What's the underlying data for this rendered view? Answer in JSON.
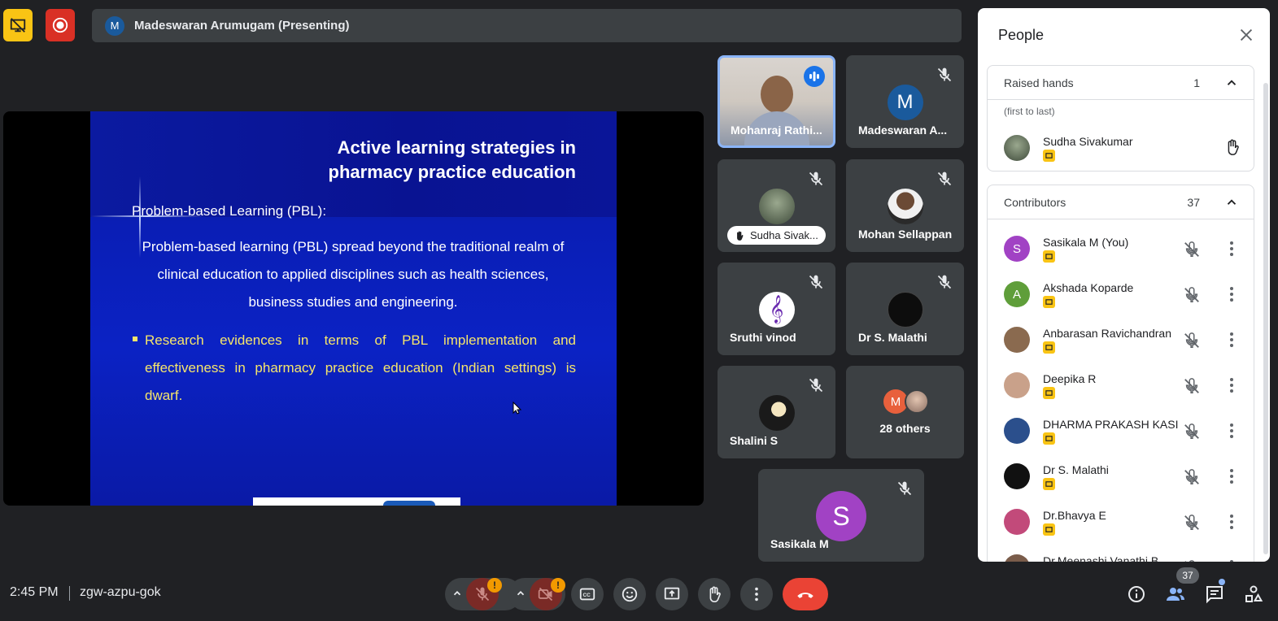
{
  "header": {
    "presenter_initial": "M",
    "presenter_label": "Madeswaran Arumugam (Presenting)"
  },
  "slide": {
    "title_line1": "Active learning strategies in",
    "title_line2": "pharmacy practice education",
    "subheading": "Problem-based Learning (PBL):",
    "paragraph": "Problem-based learning (PBL) spread beyond the traditional realm of clinical education to applied disciplines such as health sciences, business studies and engineering.",
    "bullet": "Research evidences in terms of PBL implementation and effectiveness in pharmacy practice education (Indian settings) is dwarf."
  },
  "tiles": {
    "t1": {
      "name": "Mohanraj Rathi..."
    },
    "t2": {
      "name": "Madeswaran A...",
      "initial": "M"
    },
    "t3": {
      "name": "Sudha Sivak..."
    },
    "t4": {
      "name": "Mohan Sellappan"
    },
    "t5": {
      "name": "Sruthi vinod"
    },
    "t6": {
      "name": "Dr S. Malathi"
    },
    "t7": {
      "name": "Shalini S"
    },
    "t8": {
      "name": "28 others",
      "initial": "M"
    },
    "t9": {
      "name": "Sasikala M",
      "initial": "S"
    }
  },
  "people": {
    "title": "People",
    "raised": {
      "title": "Raised hands",
      "count": "1",
      "note": "(first to last)",
      "person": "Sudha Sivakumar"
    },
    "contributors": {
      "title": "Contributors",
      "count": "37",
      "list": [
        {
          "name": "Sasikala M (You)",
          "initial": "S",
          "color": "#a142c4"
        },
        {
          "name": "Akshada Koparde",
          "initial": "A",
          "color": "#5f9e3a"
        },
        {
          "name": "Anbarasan Ravichandran",
          "initial": "",
          "color": "#8a6a4f"
        },
        {
          "name": "Deepika R",
          "initial": "",
          "color": "#c9a18a"
        },
        {
          "name": "DHARMA PRAKASH KASI",
          "initial": "",
          "color": "#2b4f8c"
        },
        {
          "name": "Dr S. Malathi",
          "initial": "",
          "color": "#111111"
        },
        {
          "name": "Dr.Bhavya E",
          "initial": "",
          "color": "#c24a7a"
        },
        {
          "name": "Dr.Meenashi Vanathi B",
          "initial": "",
          "color": "#7a5c4a"
        }
      ]
    }
  },
  "footer": {
    "time": "2:45 PM",
    "meeting_code": "zgw-azpu-gok",
    "alert_mark": "!",
    "people_count": "37"
  },
  "colors": {
    "panel_bg": "#ffffff",
    "app_bg": "#202124",
    "end_call": "#ea4335",
    "active_speaker_border": "#8ab4f8",
    "host_badge": "#f9c414"
  }
}
